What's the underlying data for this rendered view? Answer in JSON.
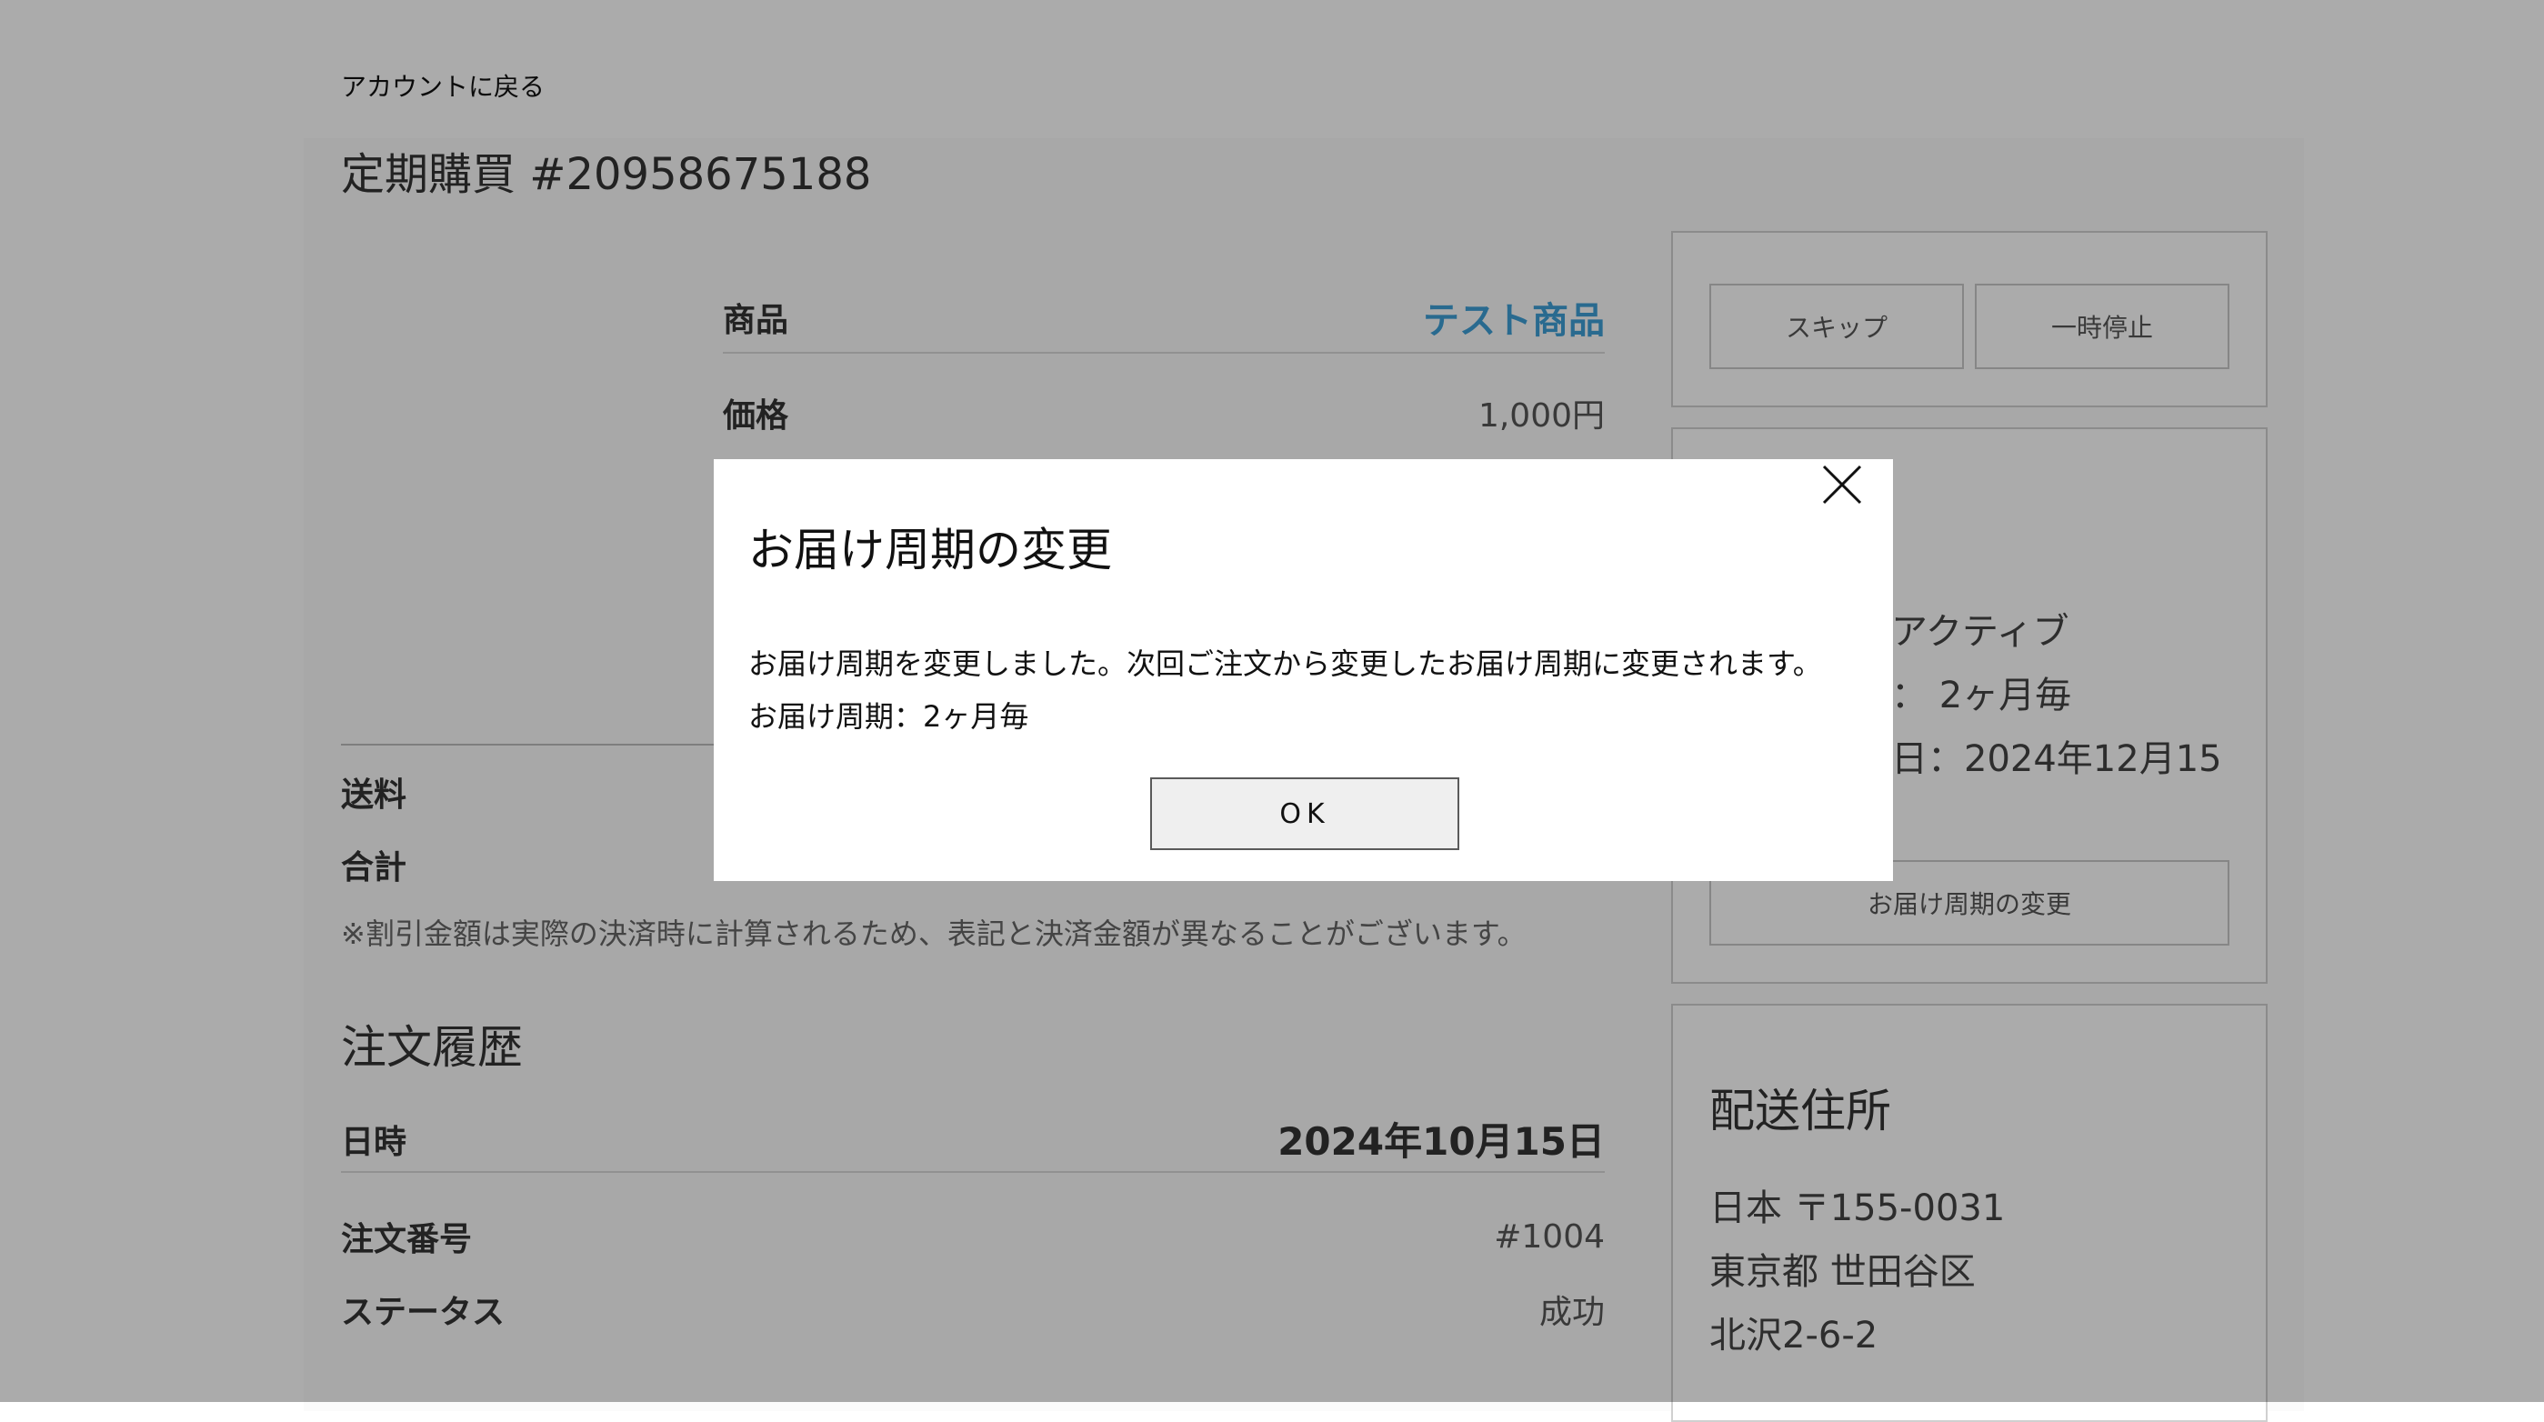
{
  "header": {
    "back_link": "アカウントに戻る"
  },
  "subscription": {
    "title": "定期購買 #20958675188",
    "product_label": "商品",
    "product_value": "テスト商品",
    "price_label": "価格",
    "price_value": "1,000円",
    "shipping_label": "送料",
    "total_label": "合計",
    "note": "※割引金額は実際の決済時に計算されるため、表記と決済金額が異なることがございます。"
  },
  "history": {
    "title": "注文履歴",
    "date_label": "日時",
    "date_value": "2024年10月15日",
    "order_no_label": "注文番号",
    "order_no_value": "#1004",
    "status_label": "ステータス",
    "status_value": "成功"
  },
  "sidebar": {
    "skip_label": "スキップ",
    "pause_label": "一時停止",
    "status_text": "アクティブ",
    "cycle_text": "：  2ヶ月毎",
    "next_date_text": "日：2024年12月15",
    "change_cycle_label": "お届け周期の変更",
    "address_title": "配送住所",
    "address_lines": [
      "日本 〒155-0031",
      "東京都 世田谷区",
      "北沢2-6-2"
    ]
  },
  "modal": {
    "title": "お届け周期の変更",
    "message": "お届け周期を変更しました。次回ご注文から変更したお届け周期に変更されます。",
    "cycle_line": "お届け周期：2ヶ月毎",
    "ok_label": "OK",
    "close_icon": "close-icon"
  }
}
